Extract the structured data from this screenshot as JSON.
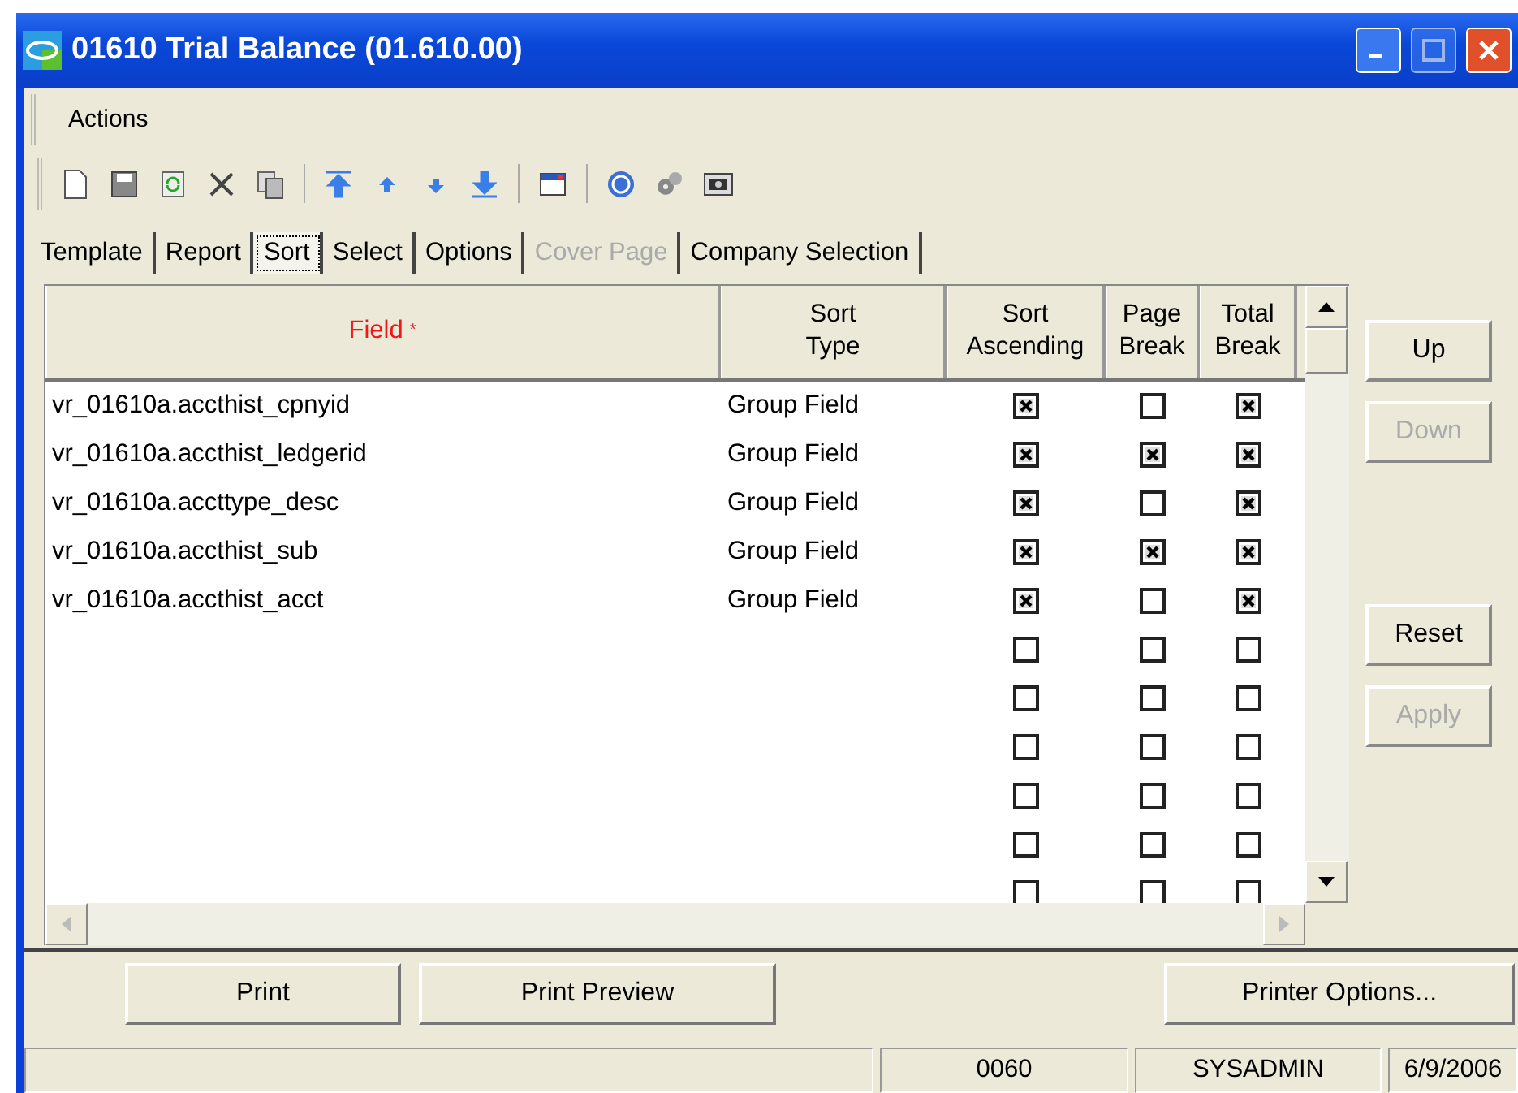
{
  "window": {
    "title": "01610 Trial Balance (01.610.00)"
  },
  "menu": [
    "Actions"
  ],
  "tabs": [
    {
      "label": "Template",
      "selected": false,
      "disabled": false
    },
    {
      "label": "Report",
      "selected": false,
      "disabled": false
    },
    {
      "label": "Sort",
      "selected": true,
      "disabled": false
    },
    {
      "label": "Select",
      "selected": false,
      "disabled": false
    },
    {
      "label": "Options",
      "selected": false,
      "disabled": false
    },
    {
      "label": "Cover Page",
      "selected": false,
      "disabled": true
    },
    {
      "label": "Company Selection",
      "selected": false,
      "disabled": false
    }
  ],
  "table": {
    "columns": [
      {
        "label": "Field",
        "required": true,
        "marker": "*"
      },
      {
        "label": "Sort Type",
        "required": false
      },
      {
        "label": "Sort Ascending",
        "required": false
      },
      {
        "label": "Page Break",
        "required": false
      },
      {
        "label": "Total Break",
        "required": false
      }
    ],
    "rows": [
      {
        "field": "vr_01610a.accthist_cpnyid",
        "sort_type": "Group Field",
        "sort_ascending": true,
        "page_break": false,
        "total_break": true
      },
      {
        "field": "vr_01610a.accthist_ledgerid",
        "sort_type": "Group Field",
        "sort_ascending": true,
        "page_break": true,
        "total_break": true
      },
      {
        "field": "vr_01610a.accttype_desc",
        "sort_type": "Group Field",
        "sort_ascending": true,
        "page_break": false,
        "total_break": true
      },
      {
        "field": "vr_01610a.accthist_sub",
        "sort_type": "Group Field",
        "sort_ascending": true,
        "page_break": true,
        "total_break": true
      },
      {
        "field": "vr_01610a.accthist_acct",
        "sort_type": "Group Field",
        "sort_ascending": true,
        "page_break": false,
        "total_break": true
      },
      {
        "sort_ascending": false,
        "page_break": false,
        "total_break": false
      },
      {
        "sort_ascending": false,
        "page_break": false,
        "total_break": false
      },
      {
        "sort_ascending": false,
        "page_break": false,
        "total_break": false
      },
      {
        "sort_ascending": false,
        "page_break": false,
        "total_break": false
      },
      {
        "sort_ascending": false,
        "page_break": false,
        "total_break": false
      },
      {
        "sort_ascending": false,
        "page_break": false,
        "total_break": false
      }
    ]
  },
  "side_buttons": [
    {
      "label": "Up",
      "disabled": false
    },
    {
      "label": "Down",
      "disabled": true
    },
    {
      "label": "Reset",
      "disabled": false
    },
    {
      "label": "Apply",
      "disabled": true
    }
  ],
  "bottom_buttons": [
    "Print",
    "Print Preview",
    "Printer Options..."
  ],
  "status_bar": [
    "0060",
    "SYSADMIN",
    "6/9/2006"
  ]
}
